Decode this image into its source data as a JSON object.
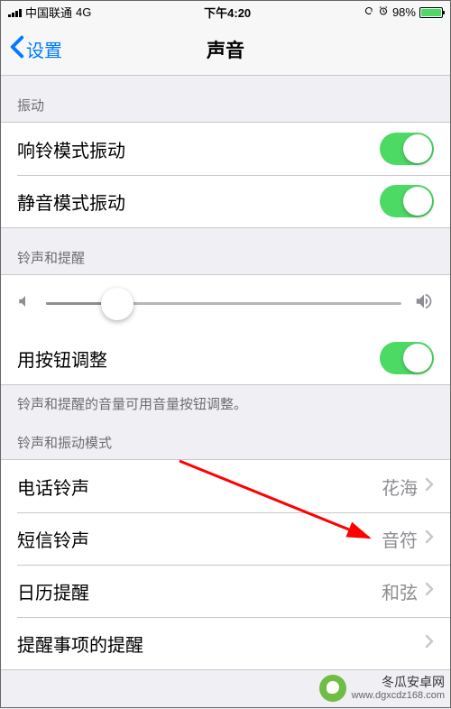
{
  "status": {
    "carrier": "中国联通",
    "network": "4G",
    "time": "下午4:20",
    "battery_percent": "98%"
  },
  "nav": {
    "back_label": "设置",
    "title": "声音"
  },
  "sections": {
    "vibrate": {
      "header": "振动",
      "ring_vibrate": "响铃模式振动",
      "silent_vibrate": "静音模式振动"
    },
    "ringer": {
      "header": "铃声和提醒",
      "button_adjust": "用按钮调整",
      "footer": "铃声和提醒的音量可用音量按钮调整。"
    },
    "patterns": {
      "header": "铃声和振动模式",
      "phone_ringtone": {
        "label": "电话铃声",
        "value": "花海"
      },
      "text_tone": {
        "label": "短信铃声",
        "value": "音符"
      },
      "calendar": {
        "label": "日历提醒",
        "value": "和弦"
      },
      "reminder": {
        "label": "提醒事项的提醒"
      }
    }
  },
  "slider": {
    "value_percent": 20
  },
  "watermark": {
    "name": "冬瓜安卓网",
    "url": "www.dgxcdz168.com"
  }
}
